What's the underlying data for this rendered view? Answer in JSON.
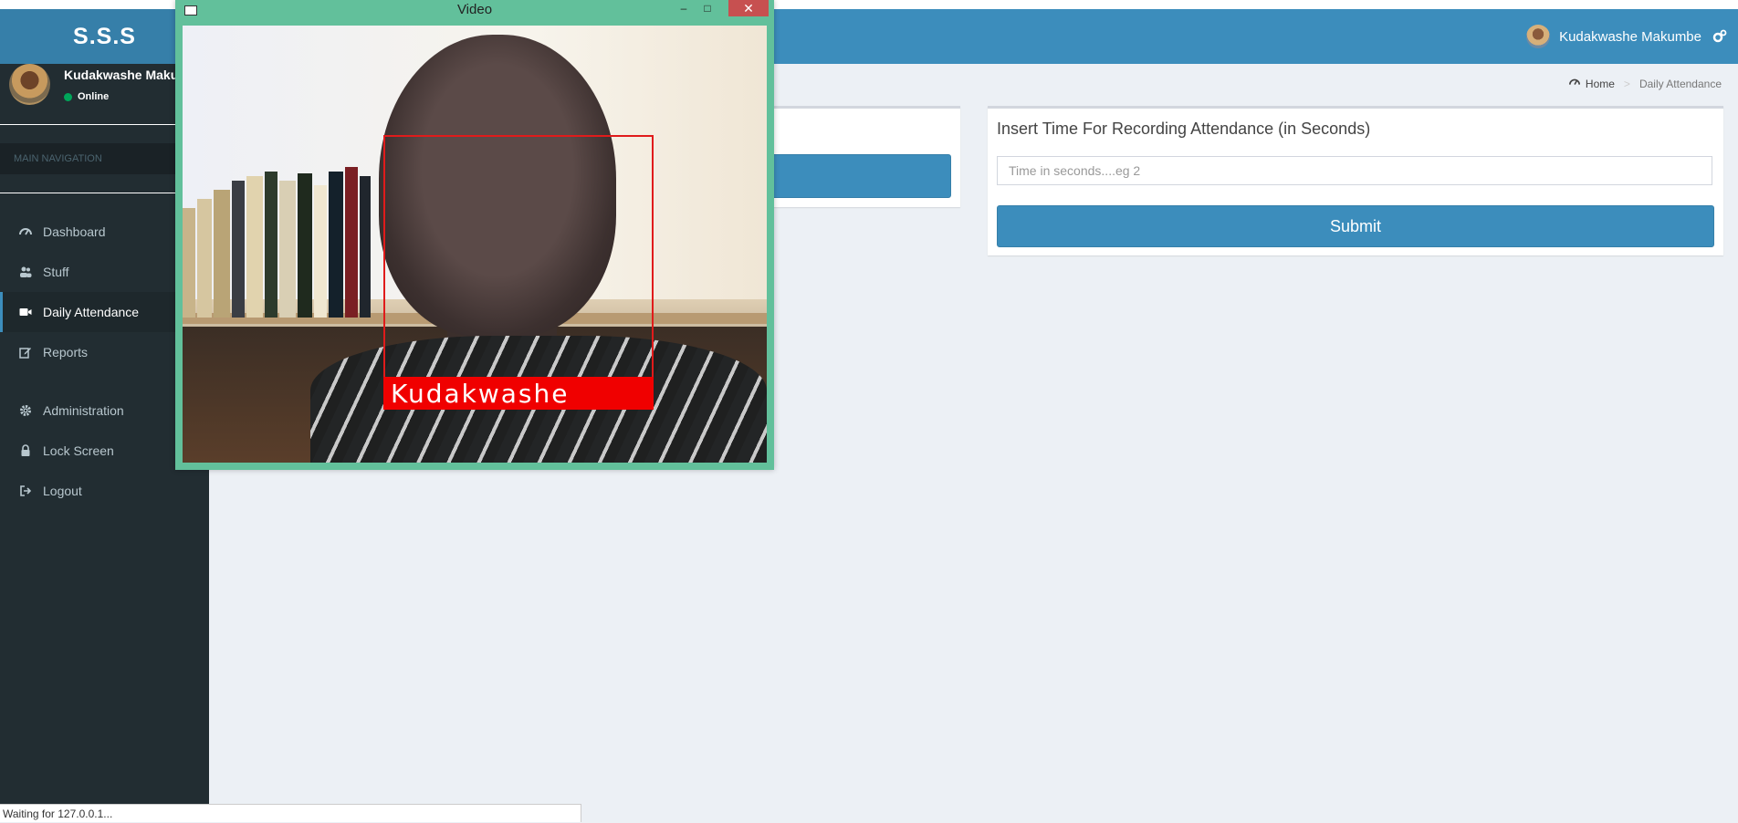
{
  "app": {
    "brand": "S.S.S",
    "user_name": "Kudakwashe Makumbe"
  },
  "sidebar": {
    "user_name": "Kudakwashe Makum",
    "status": "Online",
    "nav_header": "MAIN NAVIGATION",
    "items": [
      {
        "label": "Dashboard",
        "icon": "dashboard-icon",
        "active": false
      },
      {
        "label": "Stuff",
        "icon": "users-icon",
        "active": false
      },
      {
        "label": "Daily Attendance",
        "icon": "video-camera-icon",
        "active": true
      },
      {
        "label": "Reports",
        "icon": "edit-icon",
        "active": false
      },
      {
        "label": "Administration",
        "icon": "gear-icon",
        "active": false
      },
      {
        "label": "Lock Screen",
        "icon": "lock-icon",
        "active": false
      },
      {
        "label": "Logout",
        "icon": "sign-out-icon",
        "active": false
      }
    ]
  },
  "breadcrumb": {
    "home": "Home",
    "current": "Daily Attendance"
  },
  "attendance_box": {
    "title": "Insert Time For Recording Attendance (in Seconds)",
    "input_placeholder": "Time in seconds....eg 2",
    "submit_label": "Submit"
  },
  "video_window": {
    "title": "Video",
    "face_label": "Kudakwashe"
  },
  "statusbar": {
    "text": "Waiting for 127.0.0.1..."
  },
  "colors": {
    "header": "#3c8dbc",
    "sidebar": "#222d32",
    "face_box": "#e01b1b",
    "window_frame": "#62c09b"
  }
}
